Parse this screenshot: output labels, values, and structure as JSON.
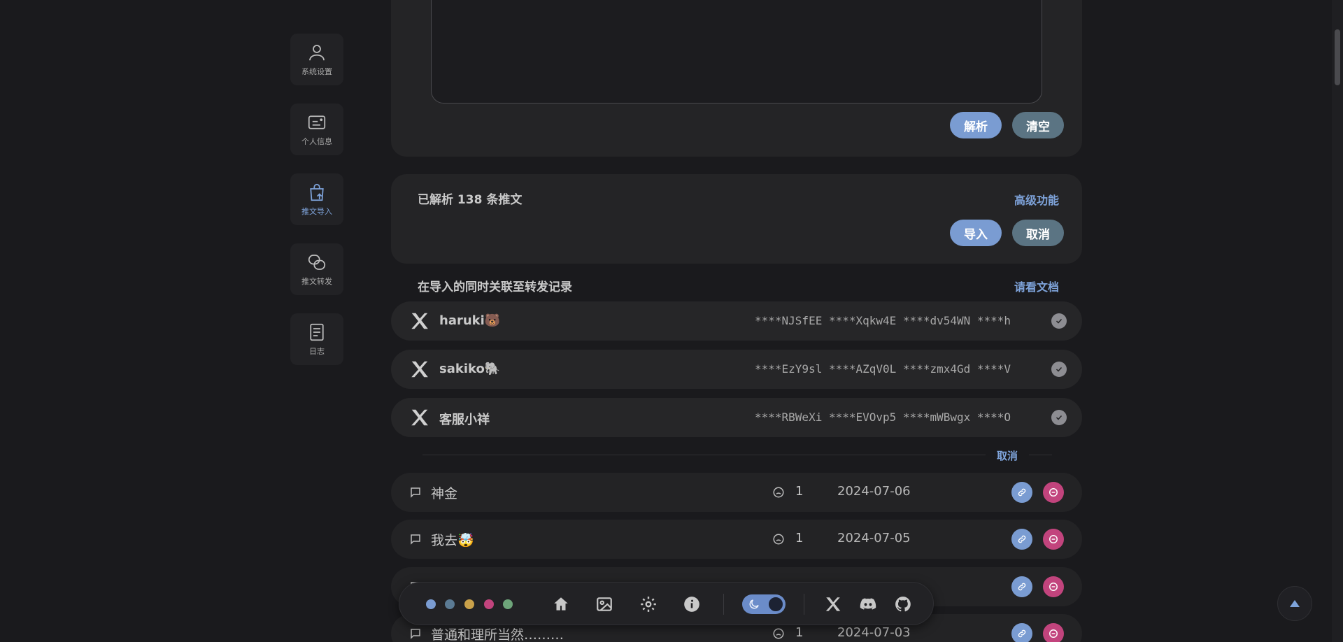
{
  "sidebar": {
    "items": [
      {
        "label": "系统设置",
        "icon": "user-icon"
      },
      {
        "label": "个人信息",
        "icon": "id-card-icon"
      },
      {
        "label": "推文导入",
        "icon": "bag-upload-icon",
        "active": true
      },
      {
        "label": "推文转发",
        "icon": "chain-icon"
      },
      {
        "label": "日志",
        "icon": "document-icon"
      }
    ]
  },
  "parse_card": {
    "parse_label": "解析",
    "clear_label": "清空"
  },
  "result_card": {
    "title": "已解析 138 条推文",
    "advanced_label": "高级功能",
    "import_label": "导入",
    "cancel_label": "取消"
  },
  "link_section": {
    "title": "在导入的同时关联至转发记录",
    "docs_label": "请看文档",
    "accounts": [
      {
        "name": "haruki🐻",
        "ids": "****NJSfEE ****Xqkw4E ****dv54WN ****h"
      },
      {
        "name": "sakiko🐘",
        "ids": "****EzY9sl ****AZqV0L ****zmx4Gd ****V"
      },
      {
        "name": "客服小祥",
        "ids": "****RBWeXi ****EVOvp5 ****mWBwgx ****O"
      }
    ],
    "cancel_label": "取消"
  },
  "tweets": [
    {
      "text": "神金",
      "count": "1",
      "date": "2024-07-06"
    },
    {
      "text": "我去🤯",
      "count": "1",
      "date": "2024-07-05"
    },
    {
      "text": "",
      "count": "",
      "date": ""
    },
    {
      "text": "普通和理所当然………",
      "count": "1",
      "date": "2024-07-03"
    }
  ],
  "bottombar": {
    "theme_colors": [
      "#7a9cd2",
      "#5b7b94",
      "#c9a14a",
      "#c2447d",
      "#6ea57a"
    ],
    "icons": [
      "home-icon",
      "image-icon",
      "gear-icon",
      "info-icon",
      "x-logo-icon",
      "discord-icon",
      "github-icon"
    ]
  },
  "colors": {
    "accent": "#7ea3da",
    "danger": "#c2447d",
    "background": "#1a1a1d"
  }
}
